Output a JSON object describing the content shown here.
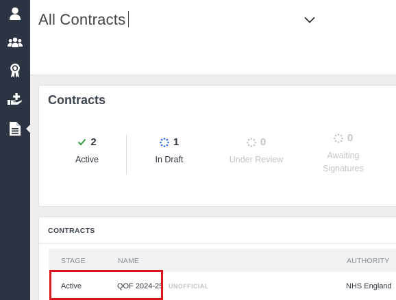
{
  "sidebar": {
    "items": [
      {
        "icon": "user-icon",
        "name": "sidebar-item-profile"
      },
      {
        "icon": "users-icon",
        "name": "sidebar-item-team"
      },
      {
        "icon": "award-icon",
        "name": "sidebar-item-awards"
      },
      {
        "icon": "hand-plus-icon",
        "name": "sidebar-item-services"
      },
      {
        "icon": "document-icon",
        "name": "sidebar-item-contracts",
        "active": true
      }
    ],
    "color": "#2b3441"
  },
  "header": {
    "title": "All Contracts"
  },
  "summary": {
    "title": "Contracts",
    "stats": [
      {
        "value": "2",
        "label": "Active",
        "icon": "check-icon",
        "color": "#2e9e3e"
      },
      {
        "value": "1",
        "label": "In Draft",
        "icon": "spinner-icon",
        "color": "#2a6fcf"
      },
      {
        "value": "0",
        "label": "Under Review",
        "icon": "spinner-icon",
        "color": "#c2c5c8"
      },
      {
        "value": "0",
        "label": "Awaiting Signatures",
        "icon": "spinner-icon",
        "color": "#c2c5c8"
      }
    ]
  },
  "contracts_list": {
    "heading": "CONTRACTS",
    "columns": [
      "STAGE",
      "NAME",
      "AUTHORITY"
    ],
    "rows": [
      {
        "stage": "Active",
        "name": "QOF 2024-25",
        "badge": "UNOFFICIAL",
        "authority": "NHS England"
      }
    ],
    "highlight_color": "#d9141a"
  }
}
